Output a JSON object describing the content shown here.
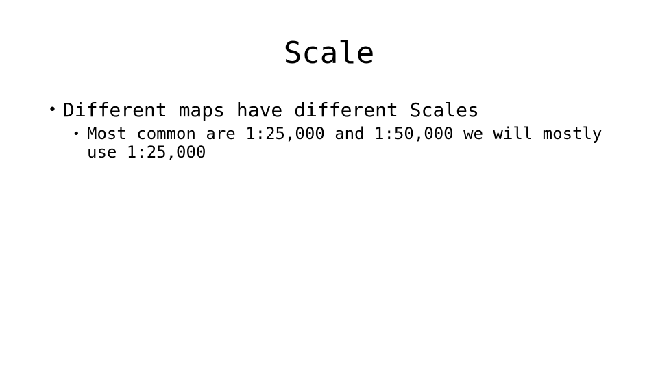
{
  "slide": {
    "background_color": "#ffffff",
    "text_color": "#000000",
    "title": "Scale",
    "bullets": [
      {
        "level": 1,
        "marker": "•",
        "text": "Different maps have different Scales"
      },
      {
        "level": 2,
        "marker": "•",
        "text": "Most common are 1:25,000 and 1:50,000 we will mostly use 1:25,000"
      }
    ]
  }
}
